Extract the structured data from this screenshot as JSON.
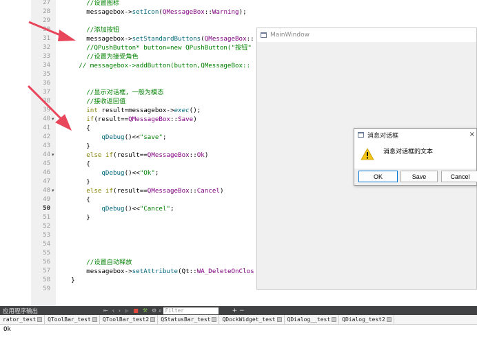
{
  "editor": {
    "lines": [
      {
        "num": "27",
        "parts": [
          {
            "t": "        ",
            "c": ""
          },
          {
            "t": "//设置图标",
            "c": "c-comment"
          }
        ]
      },
      {
        "num": "28",
        "parts": [
          {
            "t": "        messagebox->",
            "c": ""
          },
          {
            "t": "setIcon",
            "c": "c-func"
          },
          {
            "t": "(",
            "c": ""
          },
          {
            "t": "QMessageBox",
            "c": "c-macro"
          },
          {
            "t": "::",
            "c": ""
          },
          {
            "t": "Warning",
            "c": "c-macro"
          },
          {
            "t": ");",
            "c": ""
          }
        ]
      },
      {
        "num": "29",
        "parts": []
      },
      {
        "num": "30",
        "parts": [
          {
            "t": "        ",
            "c": ""
          },
          {
            "t": "//添加按钮",
            "c": "c-comment"
          }
        ]
      },
      {
        "num": "31",
        "parts": [
          {
            "t": "        messagebox->",
            "c": ""
          },
          {
            "t": "setStandardButtons",
            "c": "c-func"
          },
          {
            "t": "(",
            "c": ""
          },
          {
            "t": "QMessageBox",
            "c": "c-macro"
          },
          {
            "t": "::",
            "c": ""
          }
        ]
      },
      {
        "num": "32",
        "parts": [
          {
            "t": "        ",
            "c": ""
          },
          {
            "t": "//QPushButton* button=new QPushButton(\"按钮\"",
            "c": "c-comment"
          }
        ]
      },
      {
        "num": "33",
        "parts": [
          {
            "t": "        ",
            "c": ""
          },
          {
            "t": "//设置为接受角色",
            "c": "c-comment"
          }
        ]
      },
      {
        "num": "34",
        "parts": [
          {
            "t": "      ",
            "c": ""
          },
          {
            "t": "// messagebox->addButton(button,QMessageBox::",
            "c": "c-comment"
          }
        ]
      },
      {
        "num": "35",
        "parts": []
      },
      {
        "num": "36",
        "parts": []
      },
      {
        "num": "37",
        "parts": [
          {
            "t": "        ",
            "c": ""
          },
          {
            "t": "//显示对话框，一般为模态",
            "c": "c-comment"
          }
        ]
      },
      {
        "num": "38",
        "parts": [
          {
            "t": "        ",
            "c": ""
          },
          {
            "t": "//接收返回值",
            "c": "c-comment"
          }
        ]
      },
      {
        "num": "39",
        "parts": [
          {
            "t": "        ",
            "c": ""
          },
          {
            "t": "int",
            "c": "c-kw"
          },
          {
            "t": " result=messagebox->",
            "c": ""
          },
          {
            "t": "exec",
            "c": "c-italic"
          },
          {
            "t": "();",
            "c": ""
          }
        ]
      },
      {
        "num": "40",
        "fold": "▾",
        "parts": [
          {
            "t": "        ",
            "c": ""
          },
          {
            "t": "if",
            "c": "c-kw"
          },
          {
            "t": "(result==",
            "c": ""
          },
          {
            "t": "QMessageBox",
            "c": "c-macro"
          },
          {
            "t": "::",
            "c": ""
          },
          {
            "t": "Save",
            "c": "c-macro"
          },
          {
            "t": ")",
            "c": ""
          }
        ]
      },
      {
        "num": "41",
        "parts": [
          {
            "t": "        {",
            "c": ""
          }
        ]
      },
      {
        "num": "42",
        "parts": [
          {
            "t": "            ",
            "c": ""
          },
          {
            "t": "qDebug",
            "c": "c-func"
          },
          {
            "t": "()<<",
            "c": ""
          },
          {
            "t": "\"save\"",
            "c": "c-str"
          },
          {
            "t": ";",
            "c": ""
          }
        ]
      },
      {
        "num": "43",
        "parts": [
          {
            "t": "        }",
            "c": ""
          }
        ]
      },
      {
        "num": "44",
        "fold": "▾",
        "parts": [
          {
            "t": "        ",
            "c": ""
          },
          {
            "t": "else if",
            "c": "c-kw"
          },
          {
            "t": "(result==",
            "c": ""
          },
          {
            "t": "QMessageBox",
            "c": "c-macro"
          },
          {
            "t": "::",
            "c": ""
          },
          {
            "t": "Ok",
            "c": "c-macro"
          },
          {
            "t": ")",
            "c": ""
          }
        ]
      },
      {
        "num": "45",
        "parts": [
          {
            "t": "        {",
            "c": ""
          }
        ]
      },
      {
        "num": "46",
        "parts": [
          {
            "t": "            ",
            "c": ""
          },
          {
            "t": "qDebug",
            "c": "c-func"
          },
          {
            "t": "()<<",
            "c": ""
          },
          {
            "t": "\"Ok\"",
            "c": "c-str"
          },
          {
            "t": ";",
            "c": ""
          }
        ]
      },
      {
        "num": "47",
        "parts": [
          {
            "t": "        }",
            "c": ""
          }
        ]
      },
      {
        "num": "48",
        "fold": "▾",
        "parts": [
          {
            "t": "        ",
            "c": ""
          },
          {
            "t": "else if",
            "c": "c-kw"
          },
          {
            "t": "(result==",
            "c": ""
          },
          {
            "t": "QMessageBox",
            "c": "c-macro"
          },
          {
            "t": "::",
            "c": ""
          },
          {
            "t": "Cancel",
            "c": "c-macro"
          },
          {
            "t": ")",
            "c": ""
          }
        ]
      },
      {
        "num": "49",
        "parts": [
          {
            "t": "        {",
            "c": ""
          }
        ]
      },
      {
        "num": "50",
        "current": true,
        "parts": [
          {
            "t": "            ",
            "c": ""
          },
          {
            "t": "qDebug",
            "c": "c-func"
          },
          {
            "t": "()<<",
            "c": ""
          },
          {
            "t": "\"Cancel\"",
            "c": "c-str"
          },
          {
            "t": ";",
            "c": ""
          }
        ]
      },
      {
        "num": "51",
        "parts": [
          {
            "t": "        }",
            "c": ""
          }
        ]
      },
      {
        "num": "52",
        "parts": []
      },
      {
        "num": "53",
        "parts": []
      },
      {
        "num": "54",
        "parts": []
      },
      {
        "num": "55",
        "parts": []
      },
      {
        "num": "56",
        "parts": [
          {
            "t": "        ",
            "c": ""
          },
          {
            "t": "//设置自动释放",
            "c": "c-comment"
          }
        ]
      },
      {
        "num": "57",
        "parts": [
          {
            "t": "        messagebox->",
            "c": ""
          },
          {
            "t": "setAttribute",
            "c": "c-func"
          },
          {
            "t": "(Qt::",
            "c": ""
          },
          {
            "t": "WA_DeleteOnClos",
            "c": "c-macro"
          }
        ]
      },
      {
        "num": "58",
        "fold": "",
        "parts": [
          {
            "t": "    }",
            "c": ""
          }
        ]
      },
      {
        "num": "59",
        "parts": []
      }
    ]
  },
  "main_window": {
    "title": "MainWindow"
  },
  "message_box": {
    "title": "消息对话框",
    "close_glyph": "×",
    "text": "消息对话框的文本",
    "buttons": {
      "ok": "OK",
      "save": "Save",
      "cancel": "Cancel"
    }
  },
  "output_panel": {
    "label": "应用程序输出",
    "filter_placeholder": "Filter",
    "add_glyph": "+ −",
    "tabs": [
      "rator_test",
      "QToolBar_test",
      "QToolBar_test2",
      "QStatusBar_test",
      "QDockWidget_test",
      "QDialog__test",
      "QDialog_test2"
    ],
    "content": "Ok"
  },
  "colors": {
    "accent": "#0078d7",
    "arrow": "#e8465a",
    "comment": "#008000",
    "macro": "#800080"
  }
}
